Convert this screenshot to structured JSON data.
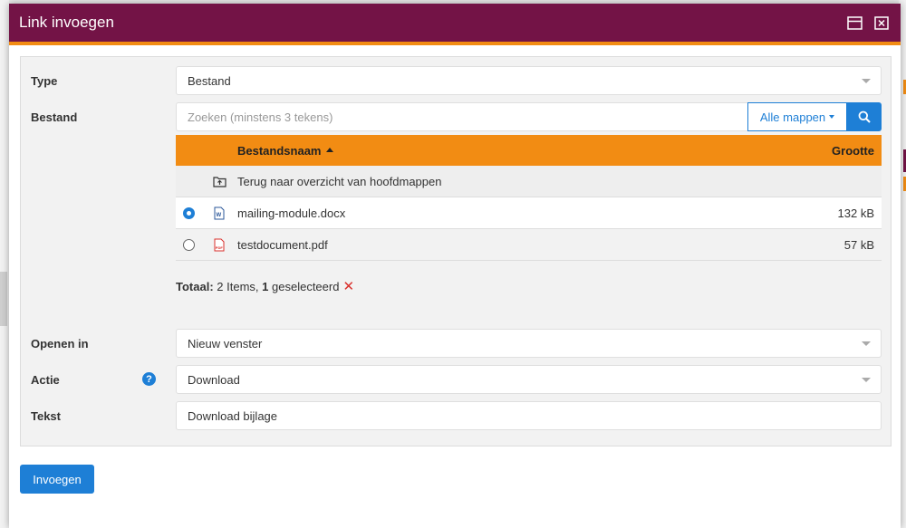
{
  "dialog": {
    "title": "Link invoegen"
  },
  "form": {
    "type_label": "Type",
    "type_value": "Bestand",
    "file_label": "Bestand",
    "search_placeholder": "Zoeken (minstens 3 tekens)",
    "folder_button": "Alle mappen",
    "open_label": "Openen in",
    "open_value": "Nieuw venster",
    "action_label": "Actie",
    "action_value": "Download",
    "text_label": "Tekst",
    "text_value": "Download bijlage"
  },
  "file_table": {
    "columns": [
      "Bestandsnaam",
      "Grootte"
    ],
    "back_row": "Terug naar overzicht van hoofdmappen",
    "rows": [
      {
        "name": "mailing-module.docx",
        "size": "132 kB",
        "selected": true,
        "icon": "word-file-icon"
      },
      {
        "name": "testdocument.pdf",
        "size": "57 kB",
        "selected": false,
        "icon": "pdf-file-icon"
      }
    ]
  },
  "summary": {
    "total_label": "Totaal:",
    "count_text": "2 Items,",
    "selected_count": "1",
    "selected_text": "geselecteerd"
  },
  "footer": {
    "insert_button": "Invoegen"
  },
  "colors": {
    "header": "#731346",
    "accent": "#f28c13",
    "primary": "#1e7fd6"
  }
}
